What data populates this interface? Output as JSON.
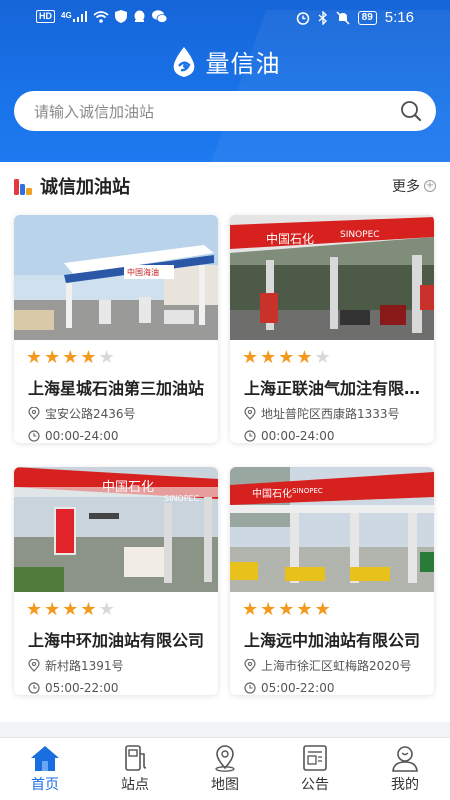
{
  "status_bar": {
    "left_icons": [
      "hd-icon",
      "4g-signal-icon",
      "wifi-icon",
      "shield-icon",
      "notification-icon",
      "chat-icon"
    ],
    "left_text_hd": "HD",
    "left_text_net": "4G",
    "right_icons": [
      "alarm-icon",
      "bluetooth-icon",
      "mute-icon"
    ],
    "battery": "89",
    "time": "5:16"
  },
  "header": {
    "app_title": "量信油",
    "search_placeholder": "请输入诚信加油站"
  },
  "section": {
    "title": "诚信加油站",
    "more_label": "更多",
    "more_plus": "+"
  },
  "stations": [
    {
      "name": "上海星城石油第三加油站",
      "rating": 4,
      "address": "宝安公路2436号",
      "hours": "00:00-24:00",
      "brand": "中国海油"
    },
    {
      "name": "上海正联油气加注有限公司",
      "rating": 4,
      "address": "地址普陀区西康路1333号",
      "hours": "00:00-24:00",
      "brand": "中国石化 SINOPEC"
    },
    {
      "name": "上海中环加油站有限公司",
      "rating": 4,
      "address": "新村路1391号",
      "hours": "05:00-22:00",
      "brand": "中国石化 SINOPEC"
    },
    {
      "name": "上海远中加油站有限公司",
      "rating": 5,
      "address": "上海市徐汇区虹梅路2020号",
      "hours": "05:00-22:00",
      "brand": "中国石化 SINOPEC"
    }
  ],
  "tabbar": {
    "items": [
      {
        "label": "首页",
        "icon": "home-icon",
        "active": true
      },
      {
        "label": "站点",
        "icon": "fuel-pump-icon",
        "active": false
      },
      {
        "label": "地图",
        "icon": "map-pin-icon",
        "active": false
      },
      {
        "label": "公告",
        "icon": "notice-icon",
        "active": false
      },
      {
        "label": "我的",
        "icon": "user-icon",
        "active": false
      }
    ]
  },
  "colors": {
    "primary": "#1a73e8",
    "star": "#f39a1e",
    "star_off": "#d8d8d8",
    "sinopec_red": "#d7211f"
  }
}
